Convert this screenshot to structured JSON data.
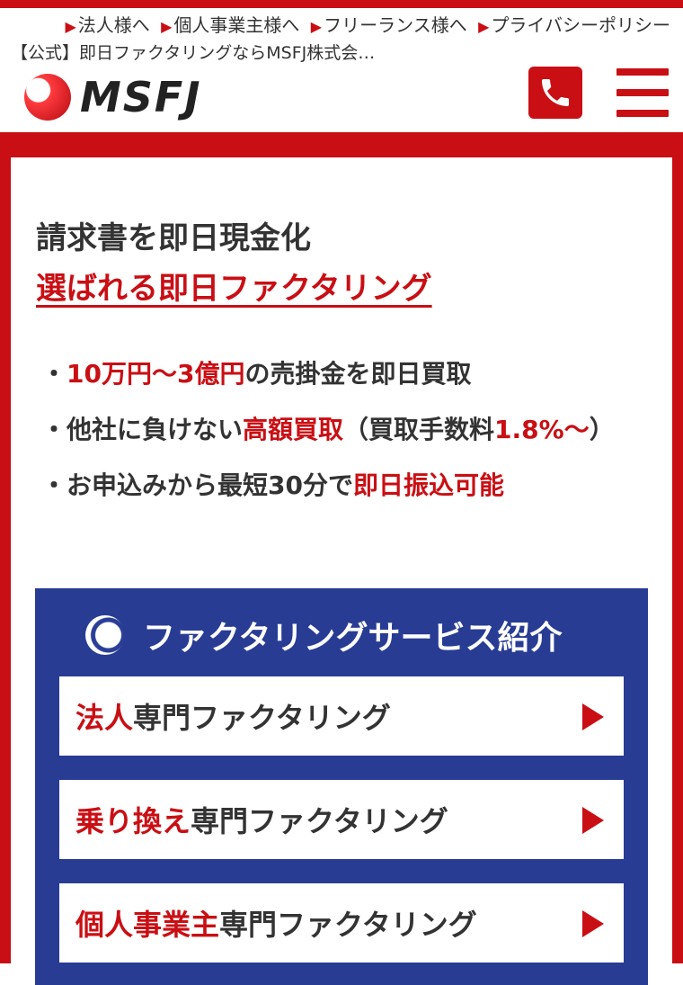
{
  "header": {
    "links": [
      "法人様へ",
      "個人事業主様へ",
      "フリーランス様へ",
      "プライバシーポリシー"
    ],
    "site_title": "【公式】即日ファクタリングならMSFJ株式会…",
    "logo_text": "MSFJ"
  },
  "hero": {
    "headline_line1": "請求書を即日現金化",
    "headline_line2": "選ばれる即日ファクタリング",
    "bullets": [
      {
        "pre": "・",
        "red1": "10万円〜3億円",
        "post1": "の売掛金を即日買取"
      },
      {
        "pre": "・他社に負けない",
        "red1": "高額買取",
        "post1": "（買取手数料",
        "red2": "1.8%〜",
        "post2": "）"
      },
      {
        "pre": "・お申込みから最短30分で",
        "red1": "即日振込可能"
      }
    ]
  },
  "service": {
    "title": "ファクタリングサービス紹介",
    "items": [
      {
        "red": "法人",
        "rest": "専門ファクタリング"
      },
      {
        "red": "乗り換え",
        "rest": "専門ファクタリング"
      },
      {
        "red": "個人事業主",
        "rest": "専門ファクタリング"
      }
    ]
  },
  "colors": {
    "brand_red": "#c90f14",
    "service_blue": "#283c94"
  }
}
